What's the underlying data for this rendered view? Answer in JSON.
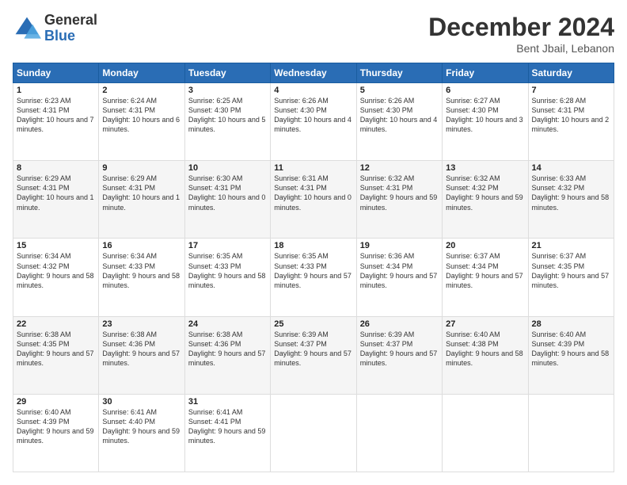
{
  "logo": {
    "general": "General",
    "blue": "Blue"
  },
  "header": {
    "month": "December 2024",
    "location": "Bent Jbail, Lebanon"
  },
  "days_of_week": [
    "Sunday",
    "Monday",
    "Tuesday",
    "Wednesday",
    "Thursday",
    "Friday",
    "Saturday"
  ],
  "weeks": [
    [
      {
        "day": "1",
        "sunrise": "6:23 AM",
        "sunset": "4:31 PM",
        "daylight": "10 hours and 7 minutes."
      },
      {
        "day": "2",
        "sunrise": "6:24 AM",
        "sunset": "4:31 PM",
        "daylight": "10 hours and 6 minutes."
      },
      {
        "day": "3",
        "sunrise": "6:25 AM",
        "sunset": "4:30 PM",
        "daylight": "10 hours and 5 minutes."
      },
      {
        "day": "4",
        "sunrise": "6:26 AM",
        "sunset": "4:30 PM",
        "daylight": "10 hours and 4 minutes."
      },
      {
        "day": "5",
        "sunrise": "6:26 AM",
        "sunset": "4:30 PM",
        "daylight": "10 hours and 4 minutes."
      },
      {
        "day": "6",
        "sunrise": "6:27 AM",
        "sunset": "4:30 PM",
        "daylight": "10 hours and 3 minutes."
      },
      {
        "day": "7",
        "sunrise": "6:28 AM",
        "sunset": "4:31 PM",
        "daylight": "10 hours and 2 minutes."
      }
    ],
    [
      {
        "day": "8",
        "sunrise": "6:29 AM",
        "sunset": "4:31 PM",
        "daylight": "10 hours and 1 minute."
      },
      {
        "day": "9",
        "sunrise": "6:29 AM",
        "sunset": "4:31 PM",
        "daylight": "10 hours and 1 minute."
      },
      {
        "day": "10",
        "sunrise": "6:30 AM",
        "sunset": "4:31 PM",
        "daylight": "10 hours and 0 minutes."
      },
      {
        "day": "11",
        "sunrise": "6:31 AM",
        "sunset": "4:31 PM",
        "daylight": "10 hours and 0 minutes."
      },
      {
        "day": "12",
        "sunrise": "6:32 AM",
        "sunset": "4:31 PM",
        "daylight": "9 hours and 59 minutes."
      },
      {
        "day": "13",
        "sunrise": "6:32 AM",
        "sunset": "4:32 PM",
        "daylight": "9 hours and 59 minutes."
      },
      {
        "day": "14",
        "sunrise": "6:33 AM",
        "sunset": "4:32 PM",
        "daylight": "9 hours and 58 minutes."
      }
    ],
    [
      {
        "day": "15",
        "sunrise": "6:34 AM",
        "sunset": "4:32 PM",
        "daylight": "9 hours and 58 minutes."
      },
      {
        "day": "16",
        "sunrise": "6:34 AM",
        "sunset": "4:33 PM",
        "daylight": "9 hours and 58 minutes."
      },
      {
        "day": "17",
        "sunrise": "6:35 AM",
        "sunset": "4:33 PM",
        "daylight": "9 hours and 58 minutes."
      },
      {
        "day": "18",
        "sunrise": "6:35 AM",
        "sunset": "4:33 PM",
        "daylight": "9 hours and 57 minutes."
      },
      {
        "day": "19",
        "sunrise": "6:36 AM",
        "sunset": "4:34 PM",
        "daylight": "9 hours and 57 minutes."
      },
      {
        "day": "20",
        "sunrise": "6:37 AM",
        "sunset": "4:34 PM",
        "daylight": "9 hours and 57 minutes."
      },
      {
        "day": "21",
        "sunrise": "6:37 AM",
        "sunset": "4:35 PM",
        "daylight": "9 hours and 57 minutes."
      }
    ],
    [
      {
        "day": "22",
        "sunrise": "6:38 AM",
        "sunset": "4:35 PM",
        "daylight": "9 hours and 57 minutes."
      },
      {
        "day": "23",
        "sunrise": "6:38 AM",
        "sunset": "4:36 PM",
        "daylight": "9 hours and 57 minutes."
      },
      {
        "day": "24",
        "sunrise": "6:38 AM",
        "sunset": "4:36 PM",
        "daylight": "9 hours and 57 minutes."
      },
      {
        "day": "25",
        "sunrise": "6:39 AM",
        "sunset": "4:37 PM",
        "daylight": "9 hours and 57 minutes."
      },
      {
        "day": "26",
        "sunrise": "6:39 AM",
        "sunset": "4:37 PM",
        "daylight": "9 hours and 57 minutes."
      },
      {
        "day": "27",
        "sunrise": "6:40 AM",
        "sunset": "4:38 PM",
        "daylight": "9 hours and 58 minutes."
      },
      {
        "day": "28",
        "sunrise": "6:40 AM",
        "sunset": "4:39 PM",
        "daylight": "9 hours and 58 minutes."
      }
    ],
    [
      {
        "day": "29",
        "sunrise": "6:40 AM",
        "sunset": "4:39 PM",
        "daylight": "9 hours and 59 minutes."
      },
      {
        "day": "30",
        "sunrise": "6:41 AM",
        "sunset": "4:40 PM",
        "daylight": "9 hours and 59 minutes."
      },
      {
        "day": "31",
        "sunrise": "6:41 AM",
        "sunset": "4:41 PM",
        "daylight": "9 hours and 59 minutes."
      },
      null,
      null,
      null,
      null
    ]
  ],
  "labels": {
    "sunrise": "Sunrise:",
    "sunset": "Sunset:",
    "daylight": "Daylight:"
  }
}
